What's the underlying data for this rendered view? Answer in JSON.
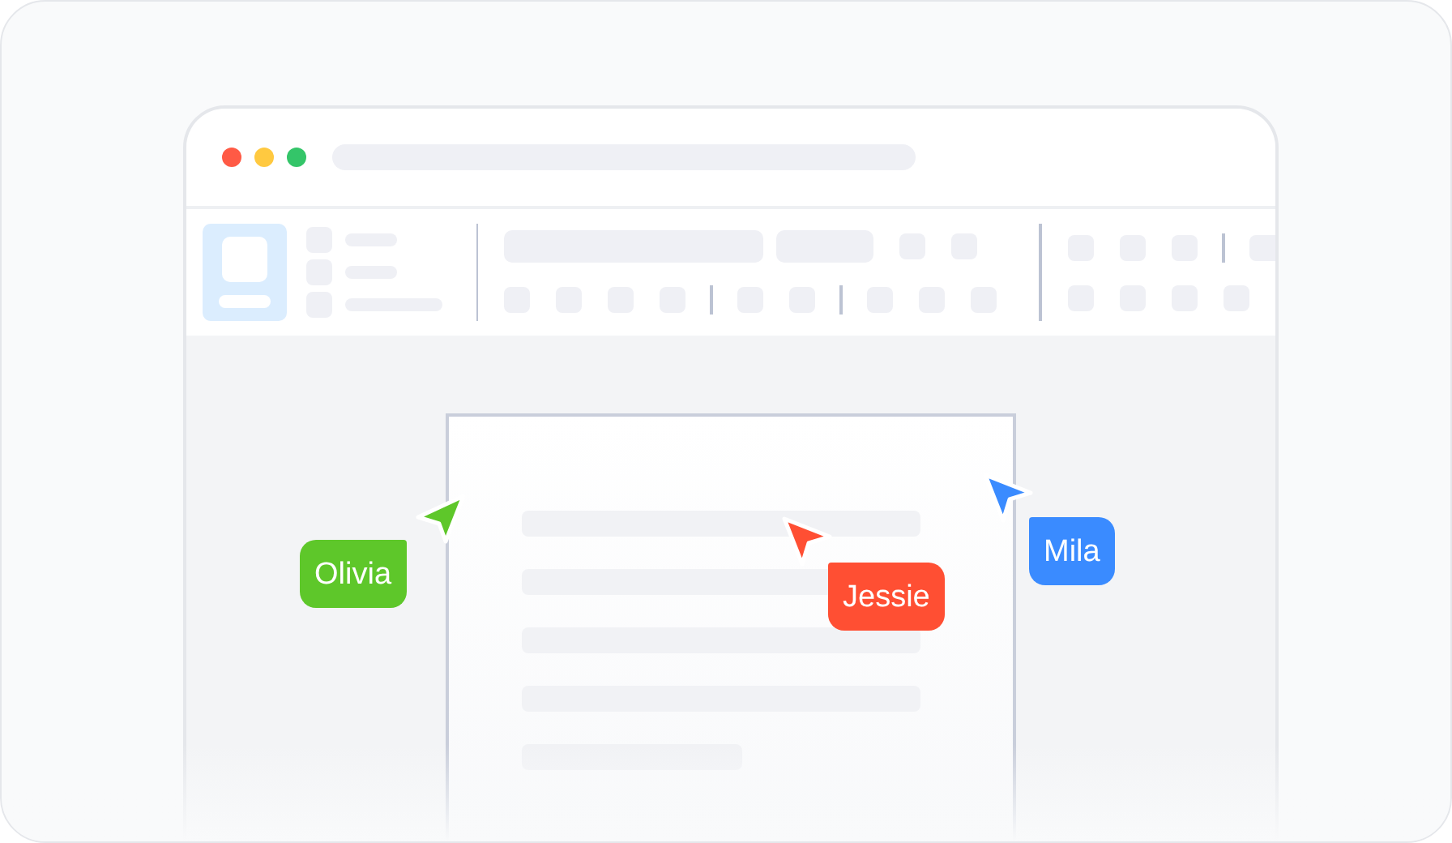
{
  "cursors": [
    {
      "name": "Olivia",
      "color": "#5ec72a"
    },
    {
      "name": "Jessie",
      "color": "#ff4f33"
    },
    {
      "name": "Mila",
      "color": "#3a8bff"
    }
  ]
}
